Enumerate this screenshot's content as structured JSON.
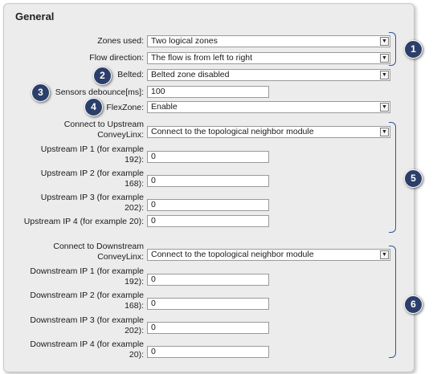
{
  "panel": {
    "title": "General"
  },
  "fields": {
    "zones_used": {
      "label": "Zones used:",
      "value": "Two logical zones"
    },
    "flow_direction": {
      "label": "Flow direction:",
      "value": "The flow is from left to right"
    },
    "belted": {
      "label": "Belted:",
      "value": "Belted zone disabled"
    },
    "sensors_debounce": {
      "label": "Sensors debounce[ms]:",
      "value": "100"
    },
    "flexzone": {
      "label": "FlexZone:",
      "value": "Enable"
    },
    "connect_upstream": {
      "label_line1": "Connect to Upstream",
      "label_line2": "ConveyLinx:",
      "value": "Connect to the topological neighbor module"
    },
    "upstream_ip1": {
      "label_line1": "Upstream IP 1 (for example",
      "label_line2": "192):",
      "value": "0"
    },
    "upstream_ip2": {
      "label_line1": "Upstream IP 2 (for example",
      "label_line2": "168):",
      "value": "0"
    },
    "upstream_ip3": {
      "label_line1": "Upstream IP 3 (for example",
      "label_line2": "202):",
      "value": "0"
    },
    "upstream_ip4": {
      "label": "Upstream IP 4 (for example 20):",
      "value": "0"
    },
    "connect_downstream": {
      "label_line1": "Connect to Downstream",
      "label_line2": "ConveyLinx:",
      "value": "Connect to the topological neighbor module"
    },
    "downstream_ip1": {
      "label_line1": "Downstream IP 1 (for example",
      "label_line2": "192):",
      "value": "0"
    },
    "downstream_ip2": {
      "label_line1": "Downstream IP 2 (for example",
      "label_line2": "168):",
      "value": "0"
    },
    "downstream_ip3": {
      "label_line1": "Downstream IP 3 (for example",
      "label_line2": "202):",
      "value": "0"
    },
    "downstream_ip4": {
      "label_line1": "Downstream IP 4 (for example",
      "label_line2": "20):",
      "value": "0"
    }
  },
  "callouts": [
    "1",
    "2",
    "3",
    "4",
    "5",
    "6"
  ],
  "icons": {
    "dropdown": "chevron-down-icon"
  },
  "colors": {
    "callout_fill": "#2c3f6a",
    "bracket": "#2b5aa0",
    "panel_bg": "#ececec"
  }
}
